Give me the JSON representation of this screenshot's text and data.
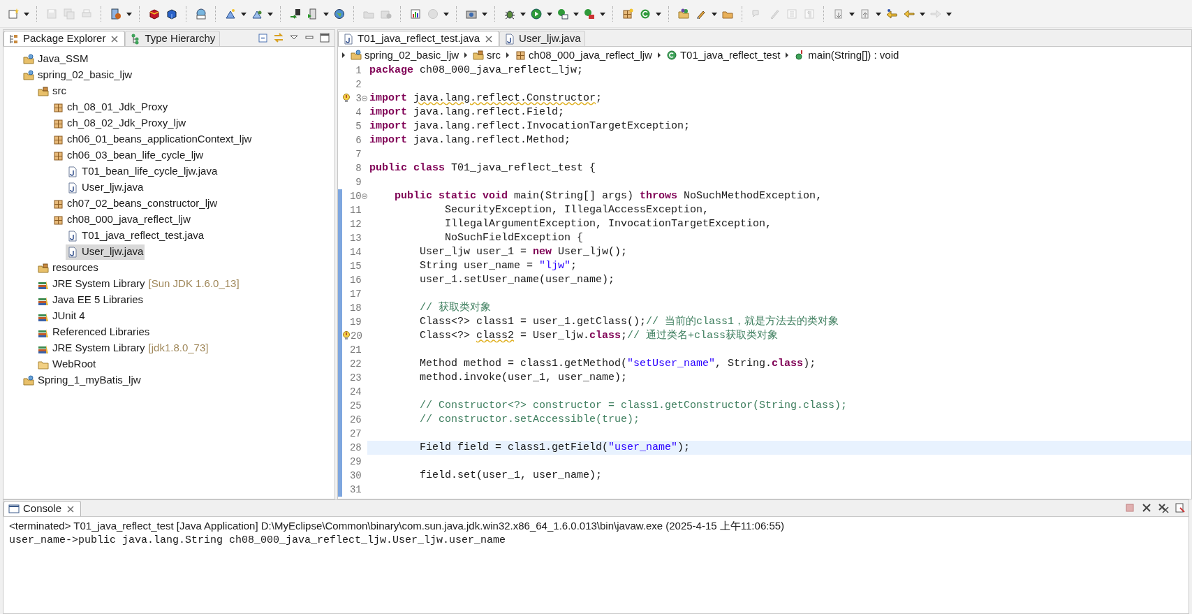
{
  "package_explorer": {
    "tabs": [
      {
        "label": "Package Explorer",
        "selected": true,
        "kind": "packages"
      },
      {
        "label": "Type Hierarchy",
        "selected": false,
        "kind": "hierarchy"
      }
    ],
    "tree": [
      {
        "label": "Java_SSM",
        "kind": "project",
        "selected": false
      },
      {
        "label": "spring_02_basic_ljw",
        "kind": "project",
        "selected": false,
        "children": [
          {
            "label": "src",
            "kind": "source-folder",
            "selected": false,
            "children": [
              {
                "label": "ch_08_01_Jdk_Proxy",
                "kind": "package",
                "selected": false
              },
              {
                "label": "ch_08_02_Jdk_Proxy_ljw",
                "kind": "package",
                "selected": false
              },
              {
                "label": "ch06_01_beans_applicationContext_ljw",
                "kind": "package",
                "selected": false
              },
              {
                "label": "ch06_03_bean_life_cycle_ljw",
                "kind": "package",
                "selected": false,
                "children": [
                  {
                    "label": "T01_bean_life_cycle_ljw.java",
                    "kind": "java-file",
                    "selected": false
                  },
                  {
                    "label": "User_ljw.java",
                    "kind": "java-file",
                    "selected": false
                  }
                ]
              },
              {
                "label": "ch07_02_beans_constructor_ljw",
                "kind": "package",
                "selected": false
              },
              {
                "label": "ch08_000_java_reflect_ljw",
                "kind": "package",
                "selected": false,
                "children": [
                  {
                    "label": "T01_java_reflect_test.java",
                    "kind": "java-file",
                    "selected": false
                  },
                  {
                    "label": "User_ljw.java",
                    "kind": "java-file",
                    "selected": true
                  }
                ]
              }
            ]
          },
          {
            "label": "resources",
            "kind": "source-folder",
            "selected": false
          },
          {
            "label": "JRE System Library",
            "decoration": "[Sun JDK 1.6.0_13]",
            "kind": "library",
            "selected": false
          },
          {
            "label": "Java EE 5 Libraries",
            "kind": "library",
            "selected": false
          },
          {
            "label": "JUnit 4",
            "kind": "library",
            "selected": false
          },
          {
            "label": "Referenced Libraries",
            "kind": "library",
            "selected": false
          },
          {
            "label": "JRE System Library",
            "decoration": "[jdk1.8.0_73]",
            "kind": "library",
            "selected": false
          },
          {
            "label": "WebRoot",
            "kind": "folder",
            "selected": false
          }
        ]
      },
      {
        "label": "Spring_1_myBatis_ljw",
        "kind": "project",
        "selected": false
      }
    ]
  },
  "editor": {
    "tabs": [
      {
        "label": "T01_java_reflect_test.java",
        "selected": true
      },
      {
        "label": "User_ljw.java",
        "selected": false
      }
    ],
    "breadcrumb": [
      {
        "label": "spring_02_basic_ljw",
        "kind": "project"
      },
      {
        "label": "src",
        "kind": "source-folder"
      },
      {
        "label": "ch08_000_java_reflect_ljw",
        "kind": "package"
      },
      {
        "label": "T01_java_reflect_test",
        "kind": "class"
      },
      {
        "label": "main(String[]) : void",
        "kind": "method"
      }
    ],
    "lines": [
      {
        "n": "1",
        "code": [
          {
            "kind": "kw",
            "text": "package"
          },
          {
            "kind": "text",
            "text": " ch08_000_java_reflect_ljw;"
          }
        ],
        "warning": false,
        "fold": false,
        "range": false,
        "current": false
      },
      {
        "n": "2",
        "warning": false,
        "fold": false,
        "range": false,
        "current": false
      },
      {
        "n": "3",
        "code": [
          {
            "kind": "kw",
            "text": "import "
          },
          {
            "kind": "warn",
            "text": "java.lang.reflect.Constructor"
          },
          {
            "kind": "text",
            "text": ";"
          }
        ],
        "warning": true,
        "fold": true,
        "range": false,
        "current": false
      },
      {
        "n": "4",
        "code": [
          {
            "kind": "kw",
            "text": "import"
          },
          {
            "kind": "text",
            "text": " java.lang.reflect.Field;"
          }
        ],
        "warning": false,
        "fold": false,
        "range": false,
        "current": false
      },
      {
        "n": "5",
        "code": [
          {
            "kind": "kw",
            "text": "import"
          },
          {
            "kind": "text",
            "text": " java.lang.reflect.InvocationTargetException;"
          }
        ],
        "warning": false,
        "fold": false,
        "range": false,
        "current": false
      },
      {
        "n": "6",
        "code": [
          {
            "kind": "kw",
            "text": "import"
          },
          {
            "kind": "text",
            "text": " java.lang.reflect.Method;"
          }
        ],
        "warning": false,
        "fold": false,
        "range": false,
        "current": false
      },
      {
        "n": "7",
        "warning": false,
        "fold": false,
        "range": false,
        "current": false
      },
      {
        "n": "8",
        "code": [
          {
            "kind": "kw",
            "text": "public class"
          },
          {
            "kind": "text",
            "text": " T01_java_reflect_test {"
          }
        ],
        "warning": false,
        "fold": false,
        "range": false,
        "current": false
      },
      {
        "n": "9",
        "warning": false,
        "fold": false,
        "range": false,
        "current": false
      },
      {
        "n": "10",
        "code": [
          {
            "kind": "kw",
            "text": "    public static void"
          },
          {
            "kind": "text",
            "text": " main(String[] args) "
          },
          {
            "kind": "kw",
            "text": "throws"
          },
          {
            "kind": "text",
            "text": " NoSuchMethodException,"
          }
        ],
        "warning": false,
        "fold": true,
        "range": true,
        "current": false
      },
      {
        "n": "11",
        "code": [
          {
            "kind": "text",
            "text": "            SecurityException, IllegalAccessException,"
          }
        ],
        "warning": false,
        "fold": false,
        "range": true,
        "current": false
      },
      {
        "n": "12",
        "code": [
          {
            "kind": "text",
            "text": "            IllegalArgumentException, InvocationTargetException,"
          }
        ],
        "warning": false,
        "fold": false,
        "range": true,
        "current": false
      },
      {
        "n": "13",
        "code": [
          {
            "kind": "text",
            "text": "            NoSuchFieldException {"
          }
        ],
        "warning": false,
        "fold": false,
        "range": true,
        "current": false
      },
      {
        "n": "14",
        "code": [
          {
            "kind": "text",
            "text": "        User_ljw user_1 = "
          },
          {
            "kind": "kw",
            "text": "new"
          },
          {
            "kind": "text",
            "text": " User_ljw();"
          }
        ],
        "warning": false,
        "fold": false,
        "range": true,
        "current": false
      },
      {
        "n": "15",
        "code": [
          {
            "kind": "text",
            "text": "        String user_name = "
          },
          {
            "kind": "str",
            "text": "\"ljw\""
          },
          {
            "kind": "text",
            "text": ";"
          }
        ],
        "warning": false,
        "fold": false,
        "range": true,
        "current": false
      },
      {
        "n": "16",
        "code": [
          {
            "kind": "text",
            "text": "        user_1.setUser_name(user_name);"
          }
        ],
        "warning": false,
        "fold": false,
        "range": true,
        "current": false
      },
      {
        "n": "17",
        "warning": false,
        "fold": false,
        "range": true,
        "current": false
      },
      {
        "n": "18",
        "code": [
          {
            "kind": "comment",
            "text": "        // 获取类对象"
          }
        ],
        "warning": false,
        "fold": false,
        "range": true,
        "current": false
      },
      {
        "n": "19",
        "code": [
          {
            "kind": "text",
            "text": "        Class<?> class1 = user_1.getClass();"
          },
          {
            "kind": "comment",
            "text": "// 当前的class1，就是方法去的类对象"
          }
        ],
        "warning": false,
        "fold": false,
        "range": true,
        "current": false
      },
      {
        "n": "20",
        "code": [
          {
            "kind": "text",
            "text": "        Class<?> "
          },
          {
            "kind": "warn",
            "text": "class2"
          },
          {
            "kind": "text",
            "text": " = User_ljw."
          },
          {
            "kind": "kw",
            "text": "class"
          },
          {
            "kind": "text",
            "text": ";"
          },
          {
            "kind": "comment",
            "text": "// 通过类名+class获取类对象"
          }
        ],
        "warning": true,
        "fold": false,
        "range": true,
        "current": false
      },
      {
        "n": "21",
        "warning": false,
        "fold": false,
        "range": true,
        "current": false
      },
      {
        "n": "22",
        "code": [
          {
            "kind": "text",
            "text": "        Method method = class1.getMethod("
          },
          {
            "kind": "str",
            "text": "\"setUser_name\""
          },
          {
            "kind": "text",
            "text": ", String."
          },
          {
            "kind": "kw",
            "text": "class"
          },
          {
            "kind": "text",
            "text": ");"
          }
        ],
        "warning": false,
        "fold": false,
        "range": true,
        "current": false
      },
      {
        "n": "23",
        "code": [
          {
            "kind": "text",
            "text": "        method.invoke(user_1, user_name);"
          }
        ],
        "warning": false,
        "fold": false,
        "range": true,
        "current": false
      },
      {
        "n": "24",
        "warning": false,
        "fold": false,
        "range": true,
        "current": false
      },
      {
        "n": "25",
        "code": [
          {
            "kind": "comment",
            "text": "        // Constructor<?> constructor = class1.getConstructor(String.class);"
          }
        ],
        "warning": false,
        "fold": false,
        "range": true,
        "current": false
      },
      {
        "n": "26",
        "code": [
          {
            "kind": "comment",
            "text": "        // constructor.setAccessible(true);"
          }
        ],
        "warning": false,
        "fold": false,
        "range": true,
        "current": false
      },
      {
        "n": "27",
        "warning": false,
        "fold": false,
        "range": true,
        "current": false
      },
      {
        "n": "28",
        "code": [
          {
            "kind": "text",
            "text": "        Field field = class1.getField("
          },
          {
            "kind": "str",
            "text": "\"user_name\""
          },
          {
            "kind": "text",
            "text": ");"
          }
        ],
        "warning": false,
        "fold": false,
        "range": true,
        "current": true
      },
      {
        "n": "29",
        "warning": false,
        "fold": false,
        "range": true,
        "current": false
      },
      {
        "n": "30",
        "code": [
          {
            "kind": "text",
            "text": "        field.set(user_1, user_name);"
          }
        ],
        "warning": false,
        "fold": false,
        "range": true,
        "current": false
      },
      {
        "n": "31",
        "warning": false,
        "fold": false,
        "range": true,
        "current": false
      }
    ]
  },
  "console": {
    "tabs": [
      {
        "label": "Console",
        "selected": true
      }
    ],
    "status": "<terminated> T01_java_reflect_test [Java Application] D:\\MyEclipse\\Common\\binary\\com.sun.java.jdk.win32.x86_64_1.6.0.013\\bin\\javaw.exe (2025-4-15 上午11:06:55)",
    "output": [
      "user_name->public java.lang.String ch08_000_java_reflect_ljw.User_ljw.user_name"
    ]
  }
}
